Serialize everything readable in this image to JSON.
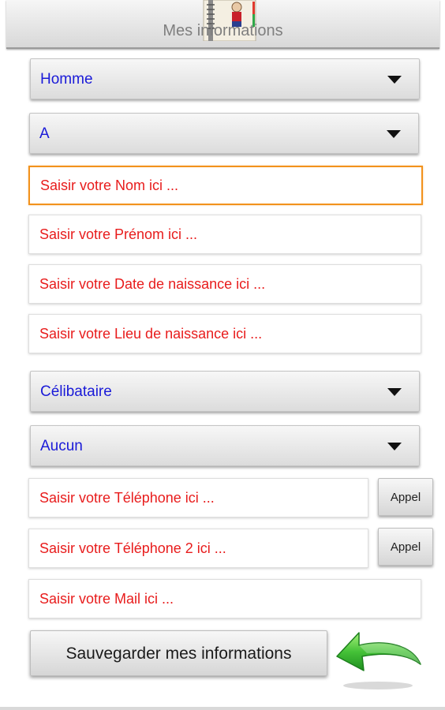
{
  "header": {
    "title": "Mes informations",
    "icon": "notebook-icon"
  },
  "form": {
    "gender_select": "Homme",
    "letter_select": "A",
    "nom_placeholder": "Saisir votre Nom ici ...",
    "prenom_placeholder": "Saisir votre Prénom ici ...",
    "birthdate_placeholder": "Saisir votre Date de naissance ici ...",
    "birthplace_placeholder": "Saisir votre Lieu de naissance ici ...",
    "marital_select": "Célibataire",
    "other_select": "Aucun",
    "phone_placeholder": "Saisir votre Téléphone ici ...",
    "phone2_placeholder": "Saisir votre Téléphone 2 ici ...",
    "mail_placeholder": "Saisir votre Mail ici ...",
    "call_label": "Appel",
    "call2_label": "Appel",
    "save_label": "Sauvegarder mes informations"
  },
  "colors": {
    "select_text": "#1a1ad8",
    "placeholder_text": "#e81c1c",
    "focus_border": "#f2921c",
    "back_arrow": "#2fb52a"
  }
}
